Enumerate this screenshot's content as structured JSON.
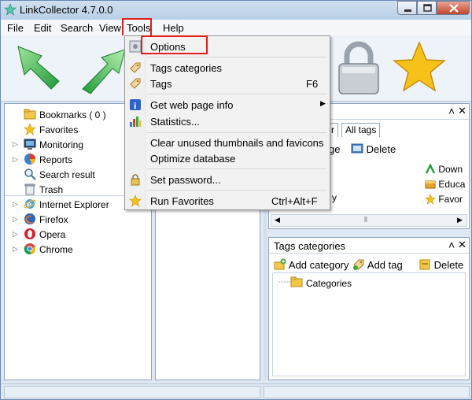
{
  "window": {
    "title": "LinkCollector 4.7.0.0"
  },
  "menubar": {
    "items": [
      "File",
      "Edit",
      "Search",
      "View",
      "Tools",
      "Help"
    ]
  },
  "sidebar": {
    "items": [
      {
        "label": "Bookmarks ( 0 )",
        "icon": "bookmarks-folder-icon",
        "expandable": false
      },
      {
        "label": "Favorites",
        "icon": "favorites-star-icon",
        "expandable": false
      },
      {
        "label": "Monitoring",
        "icon": "monitoring-icon",
        "expandable": true
      },
      {
        "label": "Reports",
        "icon": "reports-pie-icon",
        "expandable": true
      },
      {
        "label": "Search result",
        "icon": "search-icon",
        "expandable": false
      },
      {
        "label": "Trash",
        "icon": "trash-icon",
        "expandable": false
      }
    ],
    "browsers": [
      {
        "label": "Internet Explorer",
        "icon": "internet-explorer-icon"
      },
      {
        "label": "Firefox",
        "icon": "firefox-icon"
      },
      {
        "label": "Opera",
        "icon": "opera-icon"
      },
      {
        "label": "Chrome",
        "icon": "chrome-icon"
      }
    ]
  },
  "tags_panel": {
    "tabs": [
      "r",
      "All tags"
    ],
    "toolbar": {
      "partial_label": "ge",
      "delete_label": "Delete"
    },
    "left_partial": "y",
    "items": [
      "Down",
      "Educa",
      "Favor"
    ]
  },
  "tags_categories": {
    "title": "Tags categories",
    "add_category_label": "Add category",
    "add_tag_label": "Add tag",
    "delete_label": "Delete",
    "tree_root": "Categories"
  },
  "tools_menu": {
    "items": [
      {
        "label": "Options",
        "shortcut": "",
        "icon": "options-icon",
        "submenu": false
      },
      {
        "label": "Tags categories",
        "shortcut": "",
        "icon": "tag-icon",
        "submenu": false
      },
      {
        "label": "Tags",
        "shortcut": "F6",
        "icon": "tag-icon",
        "submenu": false
      },
      {
        "label": "Get web page info",
        "shortcut": "",
        "icon": "info-icon",
        "submenu": true
      },
      {
        "label": "Statistics...",
        "shortcut": "",
        "icon": "statistics-icon",
        "submenu": false
      },
      {
        "label": "Clear unused thumbnails and favicons",
        "shortcut": "",
        "icon": "",
        "submenu": false
      },
      {
        "label": "Optimize database",
        "shortcut": "",
        "icon": "",
        "submenu": false
      },
      {
        "label": "Set password...",
        "shortcut": "",
        "icon": "lock-icon",
        "submenu": false
      },
      {
        "label": "Run Favorites",
        "shortcut": "Ctrl+Alt+F",
        "icon": "run-favorites-star-icon",
        "submenu": false
      }
    ]
  },
  "colors": {
    "accent": "#e0201c",
    "arrow_green": "#35b24a",
    "star_yellow": "#f6c21a"
  }
}
